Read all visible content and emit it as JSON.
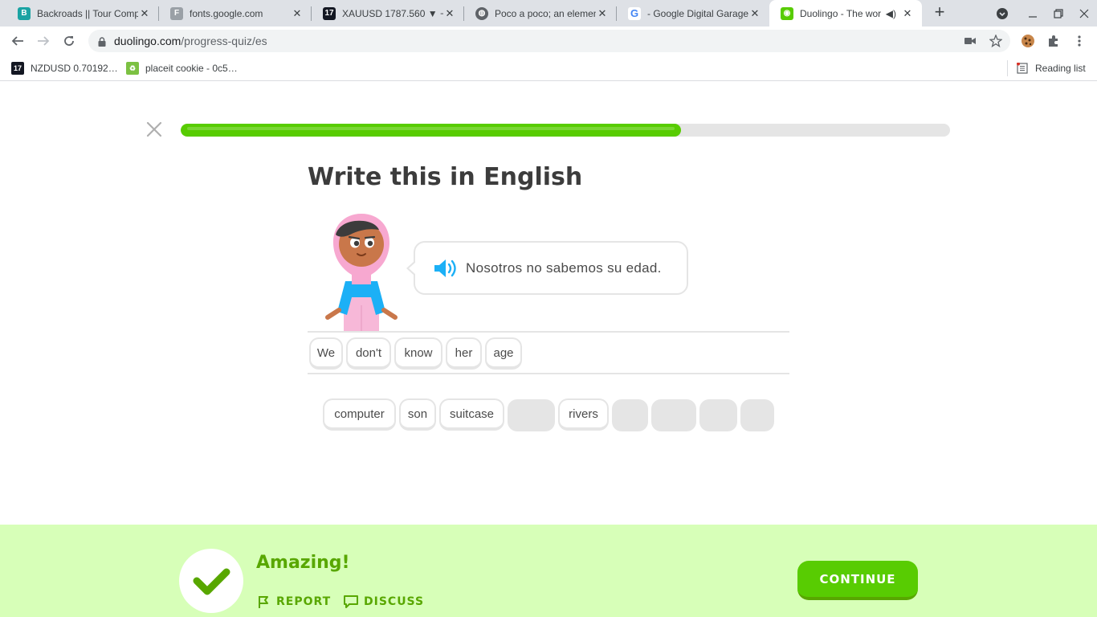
{
  "browser": {
    "tabs": [
      {
        "title": "Backroads || Tour Comp",
        "icon": "backroads-favicon",
        "color": "#1aa3a3"
      },
      {
        "title": "fonts.google.com",
        "icon": "fonts-favicon",
        "color": "#5f6368"
      },
      {
        "title": "XAUUSD 1787.560 ▼ −",
        "icon": "tradingview-favicon",
        "color": "#131722"
      },
      {
        "title": "Poco a poco; an elemen",
        "icon": "globe-favicon",
        "color": "#5f6368"
      },
      {
        "title": "- Google Digital Garage",
        "icon": "google-favicon",
        "color": "#4285f4"
      },
      {
        "title": "Duolingo - The wor",
        "icon": "duolingo-favicon",
        "color": "#58cc02"
      }
    ],
    "url_domain": "duolingo.com",
    "url_path": "/progress-quiz/es",
    "bookmarks": [
      {
        "label": "NZDUSD 0.70192…",
        "icon": "tradingview-favicon"
      },
      {
        "label": "placeit cookie - 0c5…",
        "icon": "placeit-favicon"
      }
    ],
    "reading_list": "Reading list"
  },
  "lesson": {
    "progress": 0.65,
    "prompt_title": "Write this in English",
    "sentence": "Nosotros no sabemos su edad.",
    "answer_words": [
      "We",
      "don't",
      "know",
      "her",
      "age"
    ],
    "word_bank": [
      {
        "word": "computer",
        "used": false
      },
      {
        "word": "son",
        "used": false
      },
      {
        "word": "suitcase",
        "used": false
      },
      {
        "word": "",
        "used": true
      },
      {
        "word": "rivers",
        "used": false
      },
      {
        "word": "",
        "used": true
      },
      {
        "word": "",
        "used": true
      },
      {
        "word": "",
        "used": true
      },
      {
        "word": "",
        "used": true
      }
    ]
  },
  "feedback": {
    "message": "Amazing!",
    "report_label": "REPORT",
    "discuss_label": "DISCUSS",
    "continue_label": "CONTINUE"
  },
  "colors": {
    "accent_green": "#58cc02",
    "feedback_bg": "#d7ffb8",
    "feedback_text": "#58a700"
  }
}
